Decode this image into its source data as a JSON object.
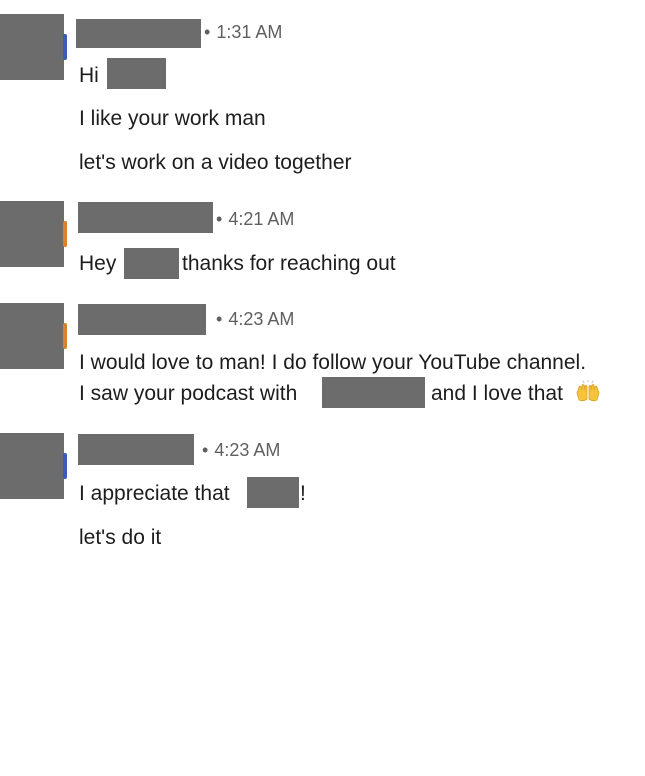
{
  "conversation": {
    "messages": [
      {
        "time": "1:31 AM",
        "lines": {
          "l1_a": "Hi",
          "l2": "I like your work man",
          "l3": "let's work on a video together"
        }
      },
      {
        "time": "4:21 AM",
        "lines": {
          "l1_a": "Hey",
          "l1_b": "thanks for reaching out"
        }
      },
      {
        "time": "4:23 AM",
        "lines": {
          "l1": "I would love to man! I do follow your YouTube channel.",
          "l2_a": "I saw your podcast with",
          "l2_b": "and I love that"
        },
        "emoji": "raising-hands"
      },
      {
        "time": "4:23 AM",
        "lines": {
          "l1_a": "I appreciate that",
          "l1_b": "!",
          "l2": "let's do it"
        }
      }
    ]
  },
  "separator_dot": "•",
  "colors": {
    "redaction": "#6c6c6c",
    "text": "#1d1d1f",
    "timestamp": "#5f5f5f",
    "avatar_edge_blue": "#3b5bb5",
    "avatar_edge_orange": "#d9822b"
  }
}
